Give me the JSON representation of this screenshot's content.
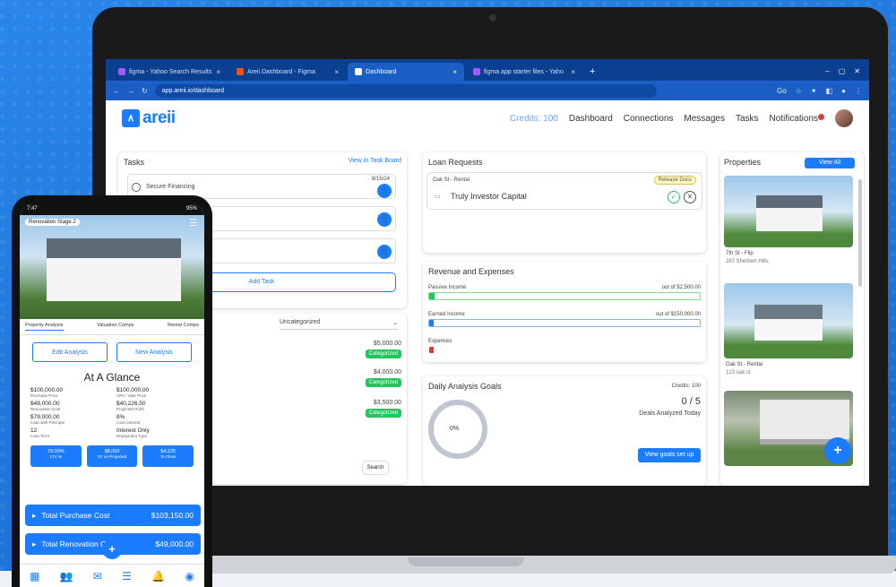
{
  "browser": {
    "tabs": [
      {
        "label": "figma - Yahoo Search Results",
        "active": false
      },
      {
        "label": "Areii Dashboard - Figma",
        "active": false
      },
      {
        "label": "Dashboard",
        "active": true
      },
      {
        "label": "figma app starter files - Yaho",
        "active": false
      }
    ],
    "url": "app.areii.io/dashboard",
    "zoom": "Go"
  },
  "header": {
    "logo": "areii",
    "credits": "Credits: 100",
    "nav": [
      "Dashboard",
      "Connections",
      "Messages",
      "Tasks",
      "Notifications"
    ]
  },
  "tasks": {
    "title": "Tasks",
    "view_link": "View in Task Board",
    "items": [
      {
        "label": "Secure Financing",
        "date": "8/15/24"
      }
    ],
    "add_label": "Add Task"
  },
  "transactions": {
    "filter": "Uncategorized",
    "rows": [
      {
        "amount": "$5,000.00",
        "status": "Categorized"
      },
      {
        "amount": "$4,000.00",
        "status": "Categorized"
      },
      {
        "amount": "$3,500.00",
        "status": "Categorized"
      }
    ],
    "search_label": "Search"
  },
  "loans": {
    "title": "Loan Requests",
    "property": "Oak St - Rental",
    "lender": "Truly Investor Capital",
    "badge": "Release Docs"
  },
  "revenue": {
    "title": "Revenue and Expenses",
    "rows": [
      {
        "label": "Passive Income",
        "target": "out of $2,500.00",
        "fill": 0.02,
        "color": "#22c55e"
      },
      {
        "label": "Earned Income",
        "target": "out of $150,000.00",
        "fill": 0.01,
        "color": "#1b7cff"
      },
      {
        "label": "Expenses",
        "target": "",
        "fill": 0.01,
        "color": "#e53935"
      }
    ]
  },
  "goals": {
    "title": "Daily Analysis Goals",
    "credits": "Credits: 100",
    "progress": "0%",
    "count": "0 / 5",
    "caption": "Deals Analyzed Today",
    "button": "View goals set up"
  },
  "properties": {
    "title": "Properties",
    "view_all": "View All",
    "items": [
      {
        "name": "7th St - Flip",
        "address": "287 Sherbert Hills"
      },
      {
        "name": "Oak St - Rental",
        "address": "123 oak st"
      }
    ]
  },
  "phone": {
    "status_time": "7:47",
    "status_right": "95%",
    "hero_label": "Renovation Stage 2",
    "tabs": [
      "Property Analysis",
      "Valuation Comps",
      "Rental Comps"
    ],
    "buttons": [
      "Edit Analysis",
      "New Analysis"
    ],
    "glance_title": "At A Glance",
    "stats": [
      {
        "value": "$100,000.00",
        "label": "Purchase Price"
      },
      {
        "value": "$100,000.00",
        "label": "ARV / Sale Price"
      },
      {
        "value": "$49,000.00",
        "label": "Renovation Cost"
      },
      {
        "value": "$40,226.50",
        "label": "Projected Profit"
      },
      {
        "value": "$79,000.00",
        "label": "Loan with Principal"
      },
      {
        "value": "8%",
        "label": "Loan Interest"
      },
      {
        "value": "12",
        "label": "Loan Term"
      },
      {
        "value": "Interest Only",
        "label": "Repayment Type"
      }
    ],
    "metrics": [
      {
        "value": "79.00%",
        "label": "LTV % "
      },
      {
        "value": "$8,000",
        "label": "CF on Projected"
      },
      {
        "value": "$4,225",
        "label": "To Close"
      }
    ],
    "bars": [
      {
        "label": "Total Purchase Cost",
        "value": "$103,150.00"
      },
      {
        "label": "Total Renovation Cost",
        "value": "$49,000.00"
      }
    ]
  }
}
